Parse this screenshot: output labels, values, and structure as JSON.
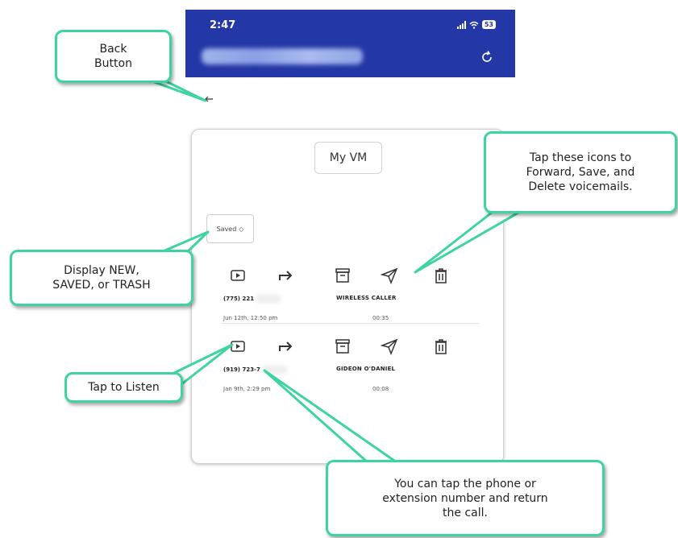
{
  "status_bar": {
    "time": "2:47",
    "battery": "53"
  },
  "page": {
    "title": "My VM"
  },
  "filter": {
    "selected": "Saved",
    "chevron": "◇"
  },
  "voicemails": [
    {
      "phone": "(775) 221",
      "caller": "WIRELESS CALLER",
      "date": "Jun 12th, 12:50 pm",
      "duration": "00:35"
    },
    {
      "phone": "(919) 723-7",
      "caller": "GIDEON O'DANIEL",
      "date": "Jan 9th, 2:29 pm",
      "duration": "00:08"
    }
  ],
  "icons": [
    "play-icon",
    "forward-icon",
    "archive-icon",
    "send-icon",
    "trash-icon",
    "back-arrow-icon",
    "refresh-icon"
  ],
  "callouts": {
    "back": "Back\nButton",
    "icons": "Tap these icons to\nForward, Save, and\nDelete voicemails.",
    "display": "Display NEW,\nSAVED, or TRASH",
    "listen": "Tap to Listen",
    "phone": "You can tap the phone or\nextension number and return\nthe call."
  },
  "colors": {
    "header": "#2437a6",
    "callout_border": "#3dd3a3"
  }
}
